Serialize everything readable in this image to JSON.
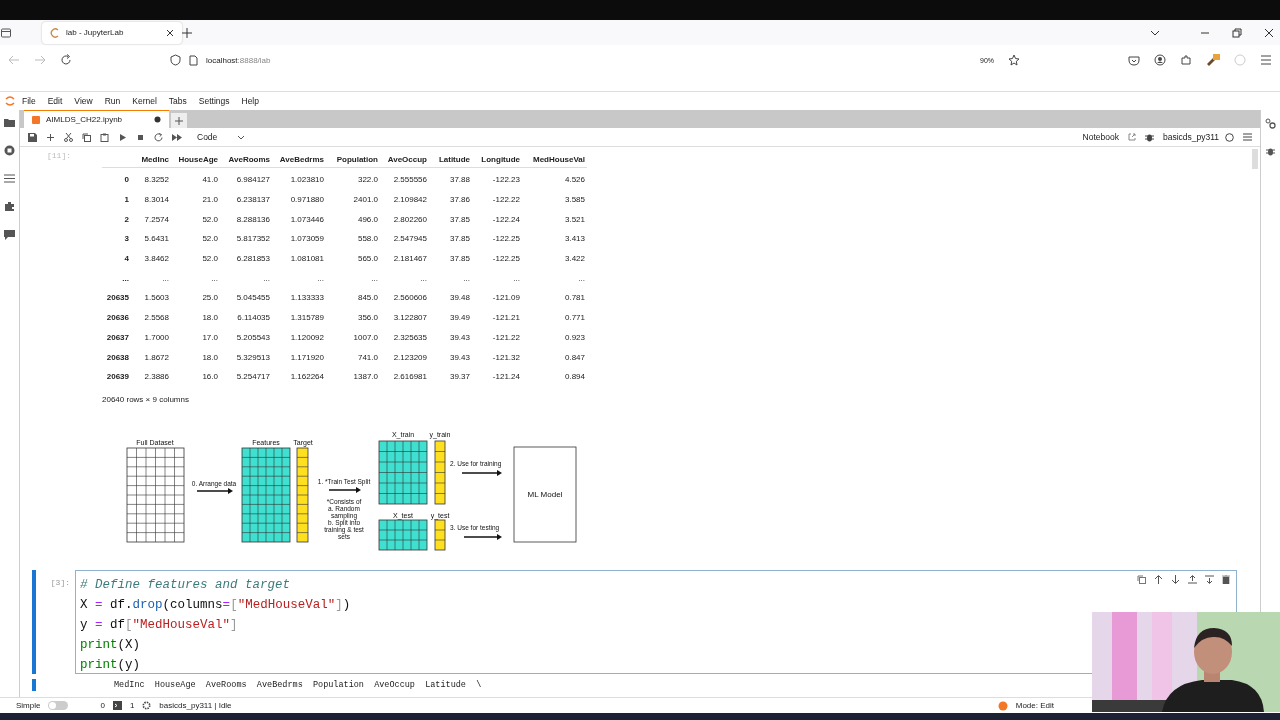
{
  "browser": {
    "tab": {
      "title": "lab - JupyterLab"
    },
    "url_host": "localhost",
    "url_path": ":8888/lab",
    "zoom": "90%"
  },
  "menu": [
    "File",
    "Edit",
    "View",
    "Run",
    "Kernel",
    "Tabs",
    "Settings",
    "Help"
  ],
  "notebook_tabs": [
    {
      "title": "AIMLDS_CH22.ipynb",
      "selected": true,
      "modified": true
    }
  ],
  "toolbar": {
    "cell_type": "Code",
    "view": "Notebook",
    "kernel": "basicds_py311"
  },
  "output_cell": {
    "prompt": "[11]:",
    "table": {
      "columns": [
        "MedInc",
        "HouseAge",
        "AveRooms",
        "AveBedrms",
        "Population",
        "AveOccup",
        "Latitude",
        "Longitude",
        "MedHouseVal"
      ],
      "rows": [
        {
          "index": "0",
          "cells": [
            "8.3252",
            "41.0",
            "6.984127",
            "1.023810",
            "322.0",
            "2.555556",
            "37.88",
            "-122.23",
            "4.526"
          ]
        },
        {
          "index": "1",
          "cells": [
            "8.3014",
            "21.0",
            "6.238137",
            "0.971880",
            "2401.0",
            "2.109842",
            "37.86",
            "-122.22",
            "3.585"
          ]
        },
        {
          "index": "2",
          "cells": [
            "7.2574",
            "52.0",
            "8.288136",
            "1.073446",
            "496.0",
            "2.802260",
            "37.85",
            "-122.24",
            "3.521"
          ]
        },
        {
          "index": "3",
          "cells": [
            "5.6431",
            "52.0",
            "5.817352",
            "1.073059",
            "558.0",
            "2.547945",
            "37.85",
            "-122.25",
            "3.413"
          ]
        },
        {
          "index": "4",
          "cells": [
            "3.8462",
            "52.0",
            "6.281853",
            "1.081081",
            "565.0",
            "2.181467",
            "37.85",
            "-122.25",
            "3.422"
          ]
        },
        {
          "index": "...",
          "cells": [
            "...",
            "...",
            "...",
            "...",
            "...",
            "...",
            "...",
            "...",
            "..."
          ]
        },
        {
          "index": "20635",
          "cells": [
            "1.5603",
            "25.0",
            "5.045455",
            "1.133333",
            "845.0",
            "2.560606",
            "39.48",
            "-121.09",
            "0.781"
          ]
        },
        {
          "index": "20636",
          "cells": [
            "2.5568",
            "18.0",
            "6.114035",
            "1.315789",
            "356.0",
            "3.122807",
            "39.49",
            "-121.21",
            "0.771"
          ]
        },
        {
          "index": "20637",
          "cells": [
            "1.7000",
            "17.0",
            "5.205543",
            "1.120092",
            "1007.0",
            "2.325635",
            "39.43",
            "-121.22",
            "0.923"
          ]
        },
        {
          "index": "20638",
          "cells": [
            "1.8672",
            "18.0",
            "5.329513",
            "1.171920",
            "741.0",
            "2.123209",
            "39.43",
            "-121.32",
            "0.847"
          ]
        },
        {
          "index": "20639",
          "cells": [
            "2.3886",
            "16.0",
            "5.254717",
            "1.162264",
            "1387.0",
            "2.616981",
            "39.37",
            "-121.24",
            "0.894"
          ]
        }
      ]
    },
    "shape": "20640 rows × 9 columns",
    "diagram": {
      "full_dataset": "Full Dataset",
      "features": "Features",
      "target": "Target",
      "x_train": "X_train",
      "y_train": "y_train",
      "x_test": "X_test",
      "y_test": "y_test",
      "model": "ML Model",
      "step_0": "0. Arrange data",
      "step_1": "1. *Train Test Split",
      "note": [
        "*Consists of",
        "a. Random",
        "sampling",
        "b. Split into",
        "training & test",
        "sets"
      ],
      "step_2": "2. Use for training",
      "step_3": "3. Use for testing"
    }
  },
  "code_cell": {
    "prompt": "[3]:",
    "active": true,
    "lines": [
      [
        {
          "t": "# Define features and target",
          "kind": "comment"
        }
      ],
      [
        {
          "t": "X",
          "kind": "var"
        },
        {
          "t": " = ",
          "kind": "op"
        },
        {
          "t": "df",
          "kind": "var"
        },
        {
          "t": ".",
          "kind": "punct"
        },
        {
          "t": "drop",
          "kind": "attr"
        },
        {
          "t": "(",
          "kind": "punct"
        },
        {
          "t": "columns",
          "kind": "var"
        },
        {
          "t": "=",
          "kind": "op"
        },
        {
          "t": "[",
          "kind": "bracket"
        },
        {
          "t": "\"MedHouseVal\"",
          "kind": "string"
        },
        {
          "t": "]",
          "kind": "bracket"
        },
        {
          "t": ")",
          "kind": "punct"
        }
      ],
      [
        {
          "t": "y",
          "kind": "var"
        },
        {
          "t": " = ",
          "kind": "op"
        },
        {
          "t": "df",
          "kind": "var"
        },
        {
          "t": "[",
          "kind": "bracket"
        },
        {
          "t": "\"MedHouseVal\"",
          "kind": "string"
        },
        {
          "t": "]",
          "kind": "bracket"
        }
      ],
      [
        {
          "t": "print",
          "kind": "builtin"
        },
        {
          "t": "(X)",
          "kind": "punct"
        }
      ],
      [
        {
          "t": "print",
          "kind": "builtin"
        },
        {
          "t": "(y)",
          "kind": "punct"
        }
      ]
    ],
    "output": "MedInc  HouseAge  AveRooms  AveBedrms  Population  AveOccup  Latitude  \\"
  },
  "status_bar": {
    "simple_mode": false,
    "simple_label": "Simple",
    "terminals": "0",
    "kernels": "1",
    "kernel_status": "basicds_py311 | Idle",
    "mode": "Mode: Edit"
  }
}
